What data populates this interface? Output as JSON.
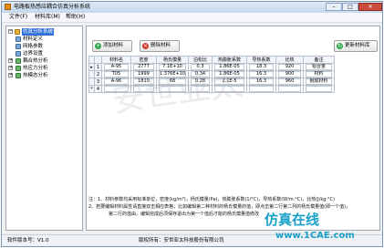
{
  "window": {
    "title": "电路板热感应耦合仿真分析系统",
    "min": "–",
    "max": "□",
    "close": "✕"
  },
  "menu": [
    "文件(F)",
    "材料库(M)",
    "帮助(H)"
  ],
  "tree": {
    "root": "仿真分析系统",
    "items": [
      "材料定义",
      "网格参数",
      "边界设置",
      "耦合热分析",
      "热应力分析",
      "热模态分析"
    ]
  },
  "toolbar": {
    "add": "添加材料",
    "delete": "删除材料",
    "update": "更新材料库"
  },
  "table": {
    "columns": [
      "",
      "材料名",
      "密度",
      "杨氏模量",
      "泊松比",
      "热膨胀系数",
      "导热系数",
      "比热",
      "备注"
    ],
    "rows": [
      {
        "marker": "▸",
        "num": "1",
        "cells": [
          "A-95",
          "2777",
          "7.1E+10",
          "0.3",
          "1.86E-05",
          "18.3",
          "920",
          "铝合金"
        ]
      },
      {
        "marker": "",
        "num": "2",
        "cells": [
          "T05",
          "1999",
          "1.376E+10",
          "0.34",
          "1.86E-05",
          "16.3",
          "900",
          "材料"
        ]
      },
      {
        "marker": "",
        "num": "3",
        "cells": [
          "A-96",
          "1810",
          "68",
          "0.28",
          "2.1E-5",
          "16.3",
          "960",
          "钢成材料"
        ]
      },
      {
        "marker": "*",
        "num": "4",
        "cells": [
          "",
          "",
          "",
          "",
          "",
          "",
          "",
          ""
        ]
      }
    ]
  },
  "notes": [
    "注：1、材料参数均采用标准单位，密度(kg/m³)，杨氏模量(Pa)，热膨胀系数(1/°C)，导热系数(W/m·°C)，比热(J/kg·°C)",
    "2、若要编辑材料属性请直接双击相应表格；比如编辑第二种材料的杨氏模量的值，即点击第二行第二列的杨氏模量值(即一个值)，",
    "第二行的值由，编辑完成后须保存退出为第一个值后才能的杨氏模量值修改"
  ],
  "status": {
    "version": "软件版本号：V1.0",
    "copyright": "版权所有：安世亚太科技股份有限公司"
  },
  "watermarks": {
    "big": "安世亚太",
    "brand": "仿真在线",
    "site": "www.1CAE.com"
  }
}
